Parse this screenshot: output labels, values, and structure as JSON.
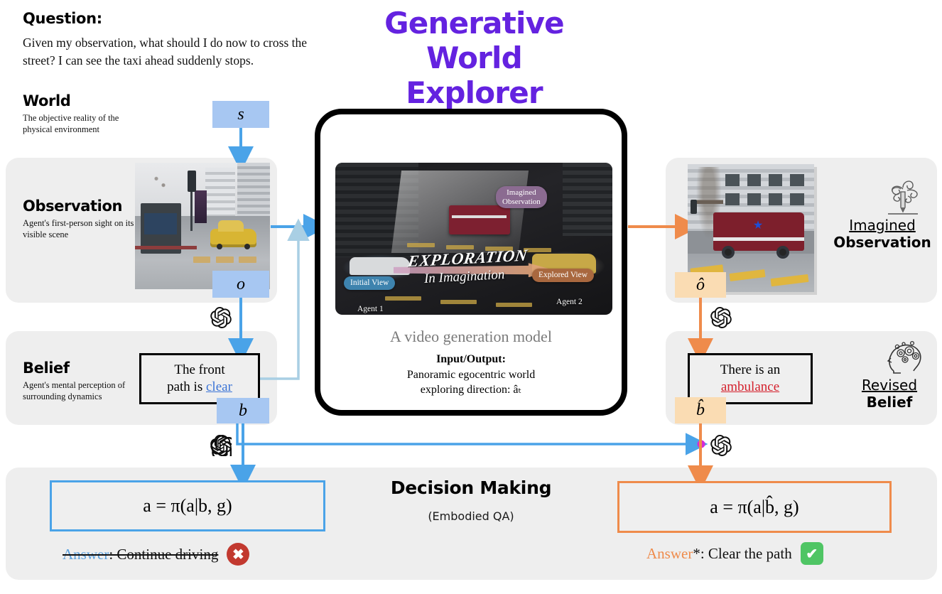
{
  "question": {
    "label": "Question:",
    "text": "Given my observation, what should I do now to cross the street? I can see the taxi ahead suddenly stops."
  },
  "title": {
    "line1": "Generative",
    "line2": "World",
    "line3": "Explorer",
    "color": "#6422e0"
  },
  "rows": {
    "world": {
      "title": "World",
      "subtitle": "The objective reality of the physical environment"
    },
    "observation": {
      "title": "Observation",
      "subtitle": "Agent's first-person sight on its visible scene"
    },
    "belief": {
      "title": "Belief",
      "subtitle": "Agent's mental perception of surrounding dynamics"
    }
  },
  "badges": {
    "state": "s",
    "observation": "o",
    "belief": "b",
    "imagined_observation": "ô",
    "revised_belief": "b̂"
  },
  "video": {
    "pill_imagined": "Imagined\nObservation",
    "pill_initial": "Initial View",
    "pill_explored": "Explored View",
    "agent1": "Agent 1",
    "agent2": "Agent 2",
    "exploration_word": "EXPLORATION",
    "exploration_sub": "In Imagination",
    "caption": "A video generation  model",
    "io_label": "Input/Output:",
    "io_text_line1": "Panoramic egocentric world",
    "io_text_line2": "exploring direction: âₜ"
  },
  "belief_boxes": {
    "left_prefix": "The front",
    "left_mid": "path is ",
    "left_highlight": "clear",
    "right_prefix": "There is an",
    "right_highlight": "ambulance"
  },
  "right_captions": {
    "imagined_underlined": "Imagined",
    "imagined_bold": "Observation",
    "revised_underlined": "Revised",
    "revised_bold": "Belief"
  },
  "decision": {
    "title": "Decision Making",
    "subtitle": "(Embodied QA)",
    "formula_left": "a = π(a|b, g)",
    "formula_right": "a = π(a|b̂, g)",
    "answer_left_word": "Answer",
    "answer_left_rest": ": Continue driving",
    "answer_right_word": "Answer",
    "answer_right_rest": "*: Clear the path",
    "mark_wrong": "✖",
    "mark_right": "✔"
  },
  "colors": {
    "accent_purple": "#6422e0",
    "blue_flow": "#4aa3e8",
    "orange_flow": "#ef8b4b",
    "badge_blue": "#a7c7f2",
    "badge_orange": "#fadcb3",
    "panel_gray": "#eeeeee",
    "magenta_dot": "#d62bd6",
    "link_blue": "#3b74d6",
    "link_red": "#d4202c"
  },
  "icons": {
    "openai": "openai-logo-icon",
    "imagination": "pencil-swirl-icon",
    "brain": "brain-head-icon"
  }
}
